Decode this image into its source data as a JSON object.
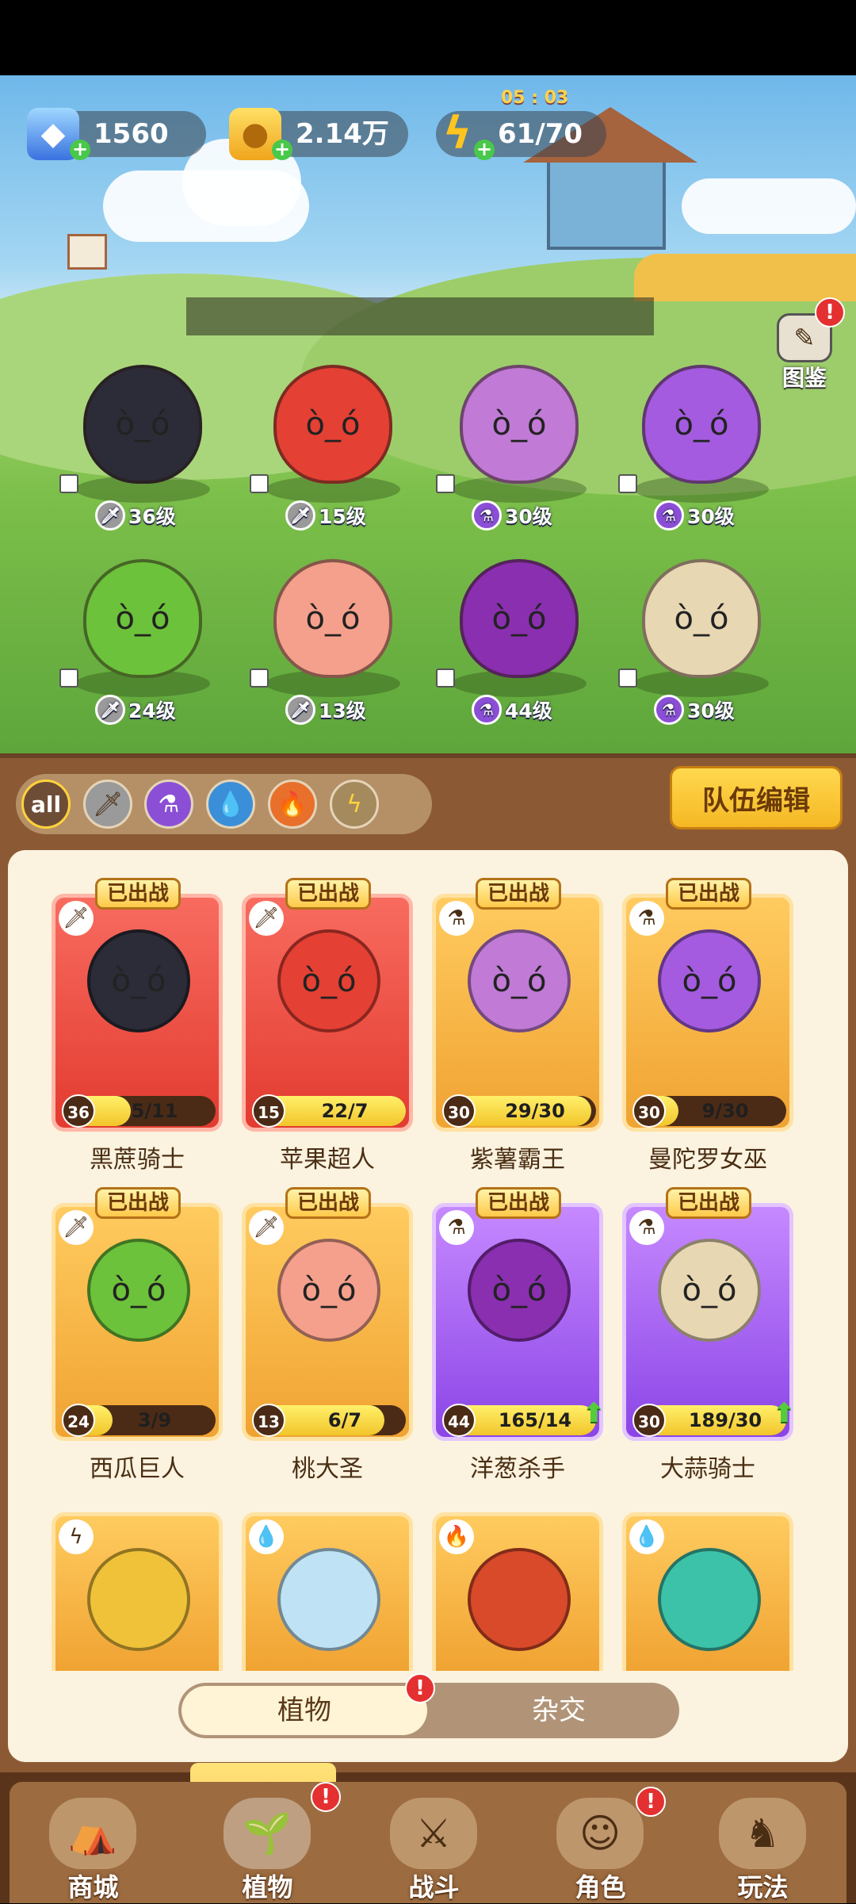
{
  "resources": {
    "gems": "1560",
    "coins": "2.14万",
    "energy": "61/70",
    "energy_timer": "05 : 03"
  },
  "gallery_label": "图鉴",
  "badge": "!",
  "team": [
    {
      "level": "36级",
      "element": "sword",
      "color": "#2c2c38"
    },
    {
      "level": "15级",
      "element": "sword",
      "color": "#e54034"
    },
    {
      "level": "30级",
      "element": "potion",
      "color": "#c17ad6"
    },
    {
      "level": "30级",
      "element": "potion",
      "color": "#a45be0"
    },
    {
      "level": "24级",
      "element": "sword",
      "color": "#6cc23a"
    },
    {
      "level": "13级",
      "element": "sword",
      "color": "#f5a08c"
    },
    {
      "level": "44级",
      "element": "potion",
      "color": "#8a2fb0"
    },
    {
      "level": "30级",
      "element": "potion",
      "color": "#e8d7b3"
    }
  ],
  "filters": {
    "all": "all",
    "items": [
      "sword",
      "potion",
      "water",
      "fire",
      "lightning"
    ]
  },
  "team_edit": "队伍编辑",
  "deployed_tag": "已出战",
  "cards": [
    {
      "name": "黑蔗骑士",
      "level": "36",
      "progress": "5/11",
      "fill": 0.45,
      "frame": "red",
      "type": "sword",
      "color": "#2c2c38",
      "up": false
    },
    {
      "name": "苹果超人",
      "level": "15",
      "progress": "22/7",
      "fill": 1.0,
      "frame": "red",
      "type": "sword",
      "color": "#e54034",
      "up": false
    },
    {
      "name": "紫薯霸王",
      "level": "30",
      "progress": "29/30",
      "fill": 0.97,
      "frame": "gold",
      "type": "potion",
      "color": "#c17ad6",
      "up": false
    },
    {
      "name": "曼陀罗女巫",
      "level": "30",
      "progress": "9/30",
      "fill": 0.3,
      "frame": "gold",
      "type": "potion",
      "color": "#a45be0",
      "up": false
    },
    {
      "name": "西瓜巨人",
      "level": "24",
      "progress": "3/9",
      "fill": 0.33,
      "frame": "gold",
      "type": "sword",
      "color": "#6cc23a",
      "up": false
    },
    {
      "name": "桃大圣",
      "level": "13",
      "progress": "6/7",
      "fill": 0.86,
      "frame": "gold",
      "type": "sword",
      "color": "#f5a08c",
      "up": false
    },
    {
      "name": "洋葱杀手",
      "level": "44",
      "progress": "165/14",
      "fill": 1.0,
      "frame": "purple",
      "type": "potion",
      "color": "#8a2fb0",
      "up": true
    },
    {
      "name": "大蒜骑士",
      "level": "30",
      "progress": "189/30",
      "fill": 1.0,
      "frame": "purple",
      "type": "potion",
      "color": "#e8d7b3",
      "up": true
    }
  ],
  "partial_cards": [
    {
      "type": "lightning",
      "color": "#f0c23a"
    },
    {
      "type": "water",
      "color": "#bfe3f5"
    },
    {
      "type": "fire",
      "color": "#d84a2a"
    },
    {
      "type": "water",
      "color": "#3cc2a8"
    }
  ],
  "toggle": {
    "left": "植物",
    "right": "杂交"
  },
  "nav": [
    "商城",
    "植物",
    "战斗",
    "角色",
    "玩法"
  ]
}
